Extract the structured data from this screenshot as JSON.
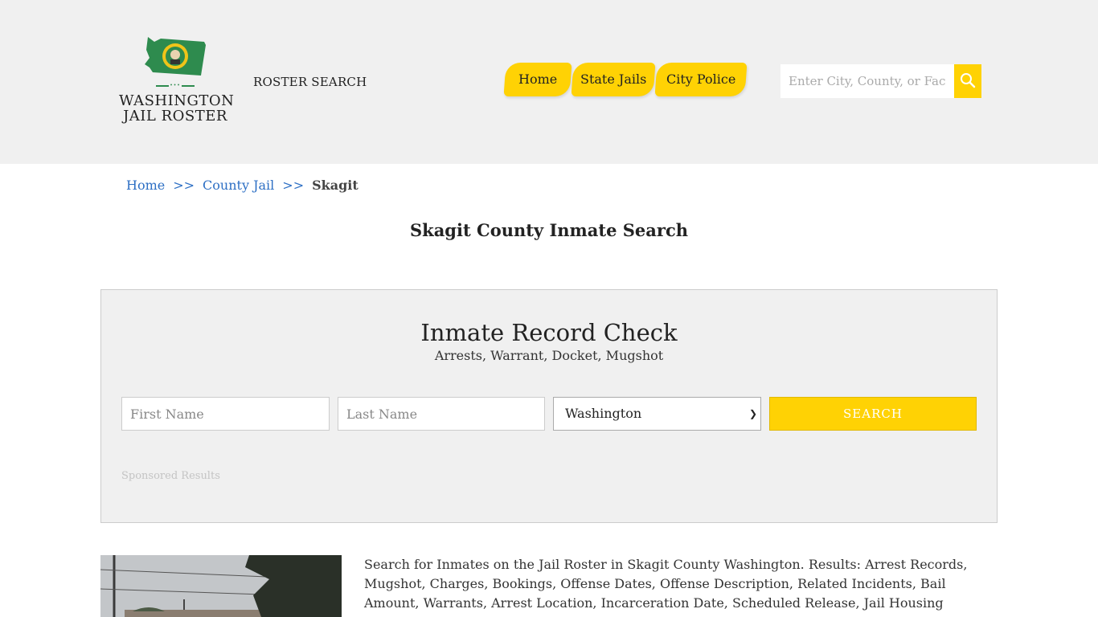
{
  "header": {
    "logo": {
      "line1": "WASHINGTON",
      "line2": "JAIL ROSTER",
      "dots": "•••"
    },
    "roster_search": "ROSTER SEARCH",
    "nav": [
      {
        "label": "Home"
      },
      {
        "label": "State Jails"
      },
      {
        "label": "City Police"
      }
    ],
    "search": {
      "placeholder": "Enter City, County, or Facility"
    }
  },
  "breadcrumb": {
    "items": [
      "Home",
      "County Jail"
    ],
    "separator": ">>",
    "current": "Skagit"
  },
  "page_title": "Skagit County Inmate Search",
  "record_check": {
    "title": "Inmate Record Check",
    "subtitle": "Arrests, Warrant, Docket, Mugshot",
    "first_name_placeholder": "First Name",
    "last_name_placeholder": "Last Name",
    "state_selected": "Washington",
    "search_label": "SEARCH",
    "sponsored": "Sponsored Results"
  },
  "description": "Search for Inmates on the Jail Roster in Skagit County Washington. Results: Arrest Records, Mugshot, Charges, Bookings, Offense Dates, Offense Description, Related Incidents, Bail Amount, Warrants, Arrest Location, Incarceration Date, Scheduled Release, Jail Housing Location, Court.",
  "colors": {
    "accent": "#ffd204",
    "header_bg": "#f0f0f0",
    "link": "#2d6fc4",
    "logo_green": "#2e8b4e"
  },
  "icons": {
    "search": "magnifier-icon",
    "state": "washington-state-map-icon",
    "select_arrow": "chevron-down-icon"
  }
}
